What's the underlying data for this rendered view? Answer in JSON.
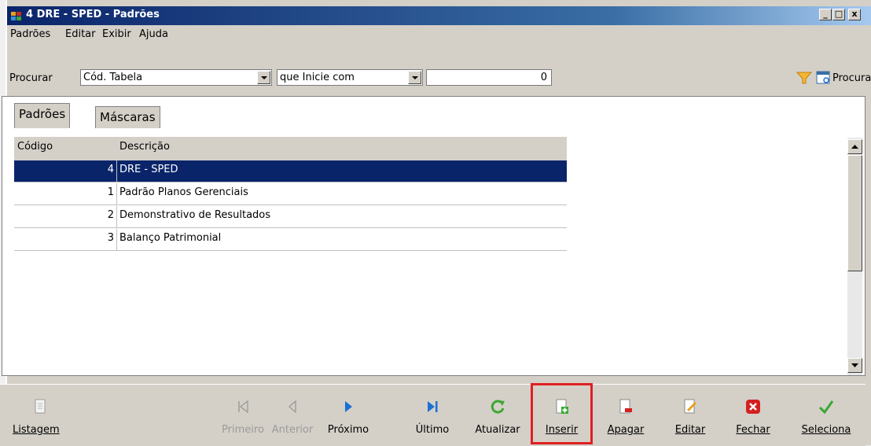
{
  "window": {
    "title": "4 DRE - SPED  -  Padrões",
    "controls": {
      "minimize": "_",
      "maximize": "□",
      "close": "x"
    }
  },
  "menu": [
    "Padrões",
    "Editar",
    "Exibir",
    "Ajuda"
  ],
  "search": {
    "label": "Procurar",
    "field_value": "Cód. Tabela",
    "condition_value": "que Inicie com",
    "query_value": "0",
    "button_label": "Procurar"
  },
  "tabs": [
    {
      "label": "Padrões",
      "active": true
    },
    {
      "label": "Máscaras",
      "active": false
    }
  ],
  "grid": {
    "columns": [
      "Código",
      "Descrição"
    ],
    "rows": [
      {
        "code": "4",
        "description": "DRE - SPED",
        "selected": true
      },
      {
        "code": "1",
        "description": "Padrão Planos Gerenciais",
        "selected": false
      },
      {
        "code": "2",
        "description": "Demonstrativo de Resultados",
        "selected": false
      },
      {
        "code": "3",
        "description": "Balanço Patrimonial",
        "selected": false
      }
    ]
  },
  "toolbar": {
    "listagem": "Listagem",
    "primeiro": "Primeiro",
    "anterior": "Anterior",
    "proximo": "Próximo",
    "ultimo": "Último",
    "atualizar": "Atualizar",
    "inserir": "Inserir",
    "apagar": "Apagar",
    "editar": "Editar",
    "fechar": "Fechar",
    "seleciona": "Seleciona"
  },
  "colors": {
    "titlebar": "#0a246a",
    "selection": "#0a246a",
    "highlight_box": "#e02020",
    "accent_green": "#3aa832",
    "accent_blue": "#1c6fd6",
    "close_red": "#d42020"
  }
}
